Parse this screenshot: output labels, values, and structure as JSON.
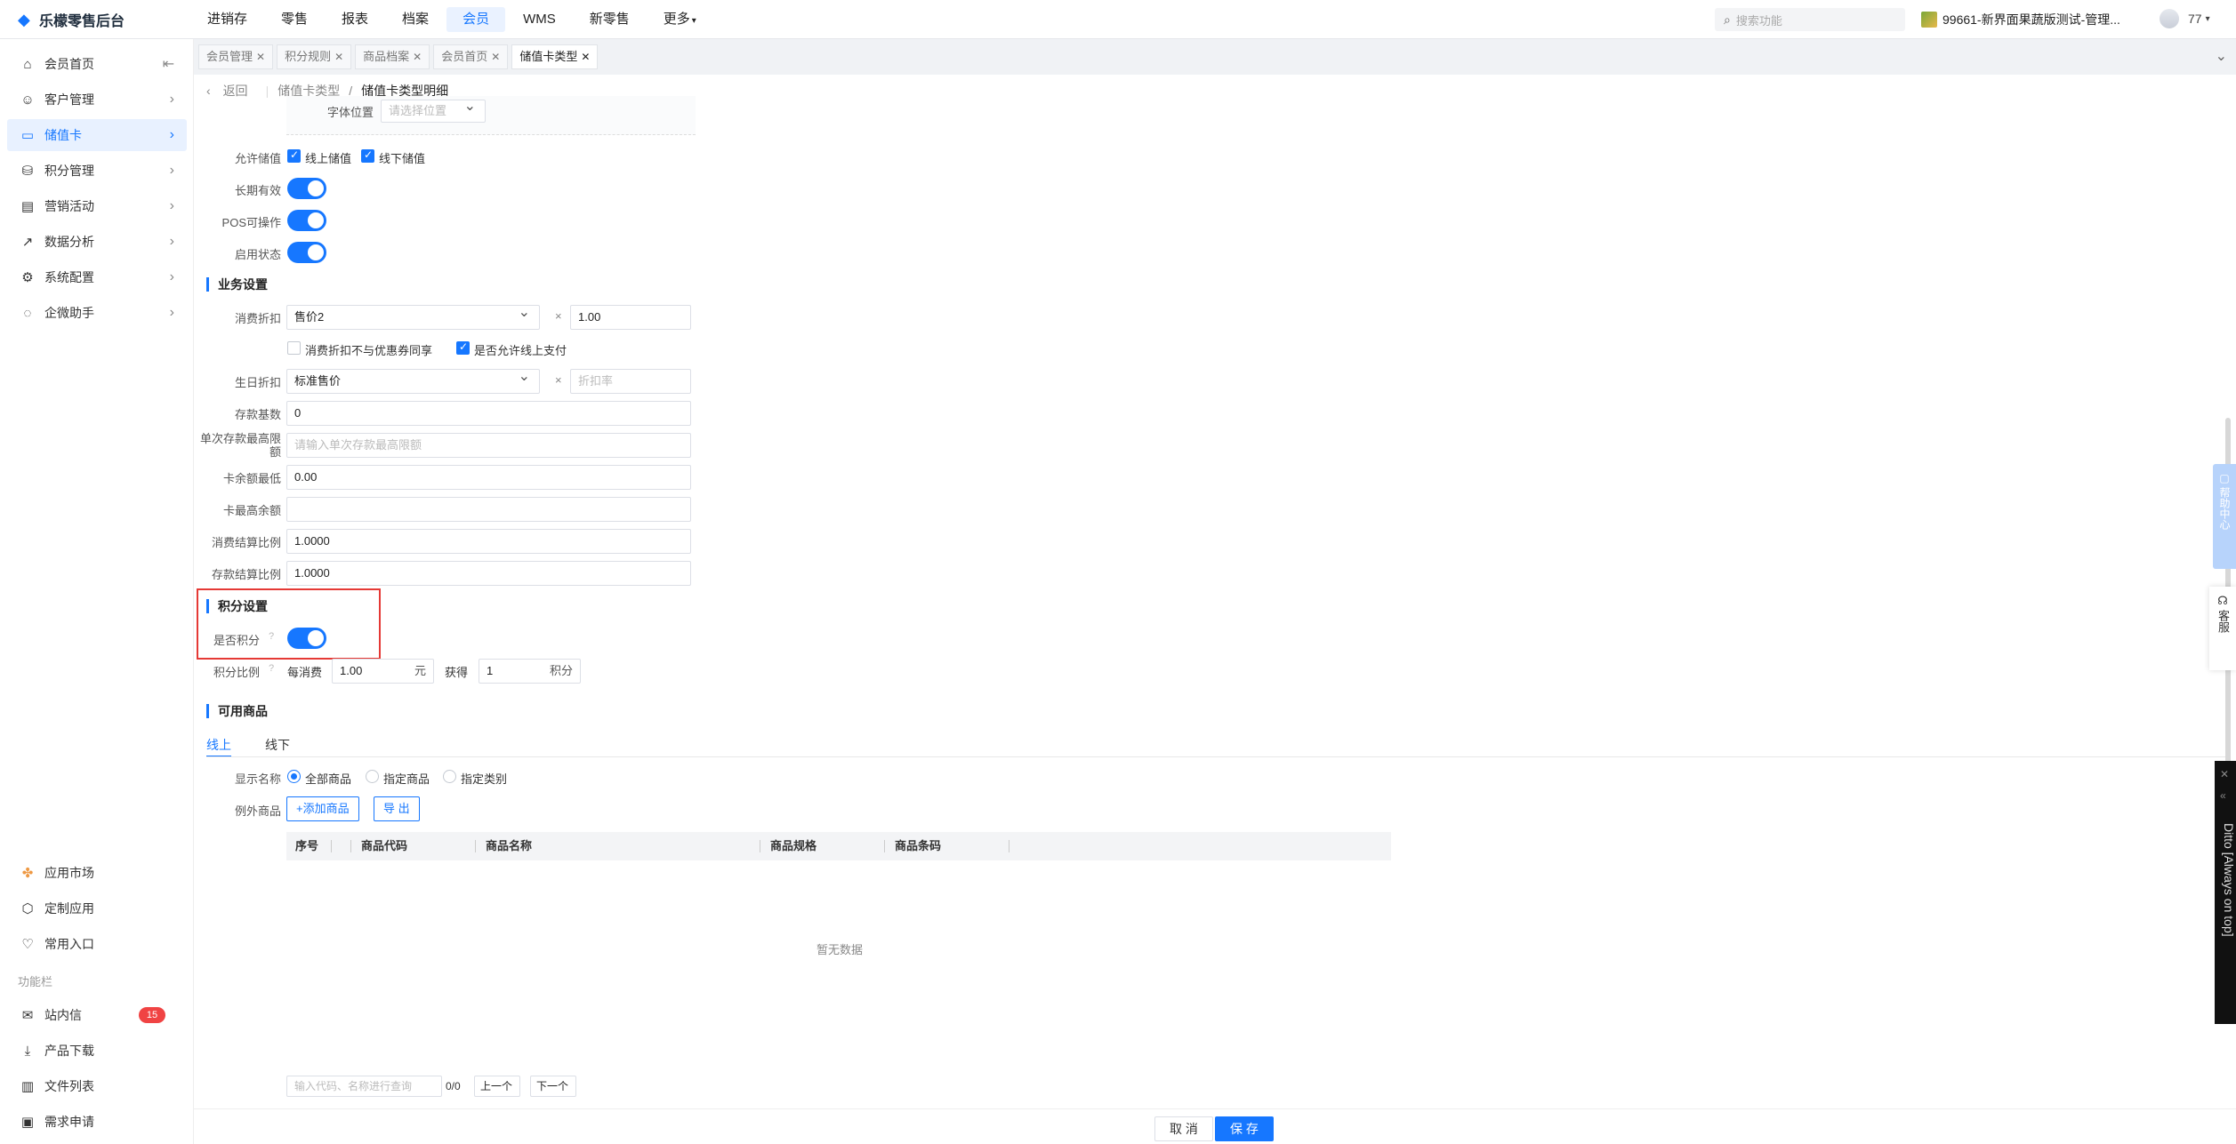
{
  "app": {
    "title": "乐檬零售后台"
  },
  "topnav": [
    "进销存",
    "零售",
    "报表",
    "档案",
    "会员",
    "WMS",
    "新零售",
    "更多"
  ],
  "topnav_active": "会员",
  "search": {
    "placeholder": "搜索功能"
  },
  "store": {
    "name": "99661-新界面果蔬版测试-管理..."
  },
  "user": {
    "name": "77"
  },
  "sidebar": {
    "items": [
      {
        "label": "会员首页",
        "icon": "home-icon"
      },
      {
        "label": "客户管理",
        "icon": "user-icon"
      },
      {
        "label": "储值卡",
        "icon": "card-icon"
      },
      {
        "label": "积分管理",
        "icon": "coins-icon"
      },
      {
        "label": "营销活动",
        "icon": "promo-icon"
      },
      {
        "label": "数据分析",
        "icon": "chart-icon"
      },
      {
        "label": "系统配置",
        "icon": "settings-icon"
      },
      {
        "label": "企微助手",
        "icon": "chat-icon"
      }
    ],
    "bottom": [
      {
        "label": "应用市场",
        "icon": "app-market-icon"
      },
      {
        "label": "定制应用",
        "icon": "custom-app-icon"
      },
      {
        "label": "常用入口",
        "icon": "heart-icon"
      }
    ],
    "toolbar_label": "功能栏",
    "toolbar": [
      {
        "label": "站内信",
        "icon": "mail-icon",
        "badge": "15"
      },
      {
        "label": "产品下载",
        "icon": "download-icon"
      },
      {
        "label": "文件列表",
        "icon": "file-list-icon"
      },
      {
        "label": "需求申请",
        "icon": "request-icon"
      }
    ]
  },
  "tabs": [
    "会员管理",
    "积分规则",
    "商品档案",
    "会员首页",
    "储值卡类型"
  ],
  "breadcrumb": {
    "back": "返回",
    "parent": "储值卡类型",
    "sep": "/",
    "current": "储值卡类型明细"
  },
  "form": {
    "font_pos_label": "字体位置",
    "font_pos_placeholder": "请选择位置",
    "allow_stored_label": "允许储值",
    "online_stored": "线上储值",
    "offline_stored": "线下储值",
    "long_valid_label": "长期有效",
    "pos_label": "POS可操作",
    "enable_label": "启用状态"
  },
  "business": {
    "title": "业务设置",
    "discount_label": "消费折扣",
    "discount_value": "售价2",
    "times": "×",
    "discount_rate": "1.00",
    "no_coupon": "消费折扣不与优惠券同享",
    "allow_online_pay": "是否允许线上支付",
    "birthday_label": "生日折扣",
    "birthday_value": "标准售价",
    "birthday_rate_placeholder": "折扣率",
    "deposit_base_label": "存款基数",
    "deposit_base_value": "0",
    "single_max_label": "单次存款最高限额",
    "single_max_placeholder": "请输入单次存款最高限额",
    "min_balance_label": "卡余额最低",
    "min_balance_value": "0.00",
    "max_balance_label": "卡最高余额",
    "consume_ratio_label": "消费结算比例",
    "consume_ratio_value": "1.0000",
    "deposit_ratio_label": "存款结算比例",
    "deposit_ratio_value": "1.0000"
  },
  "points": {
    "title": "积分设置",
    "enable_label": "是否积分",
    "ratio_label": "积分比例",
    "per_spend": "每消费",
    "spend_value": "1.00",
    "yuan": "元",
    "get": "获得",
    "points_value": "1",
    "points_unit": "积分"
  },
  "goods": {
    "title": "可用商品",
    "tab_online": "线上",
    "tab_offline": "线下",
    "show_label": "显示名称",
    "radio_all": "全部商品",
    "radio_specified": "指定商品",
    "radio_category": "指定类别",
    "except_label": "例外商品",
    "add_button": "+添加商品",
    "export_button": "导 出",
    "columns": [
      "序号",
      "商品代码",
      "商品名称",
      "商品规格",
      "商品条码"
    ],
    "empty": "暂无数据",
    "search_placeholder": "输入代码、名称进行查询",
    "count": "0/0",
    "prev": "上一个",
    "next": "下一个"
  },
  "footer": {
    "cancel": "取 消",
    "save": "保 存"
  },
  "float": {
    "help": "帮助中心",
    "service": "客服",
    "ditto": "Ditto [Always on top]"
  },
  "colors": {
    "accent": "#1677ff",
    "highlight": "#e53935"
  }
}
